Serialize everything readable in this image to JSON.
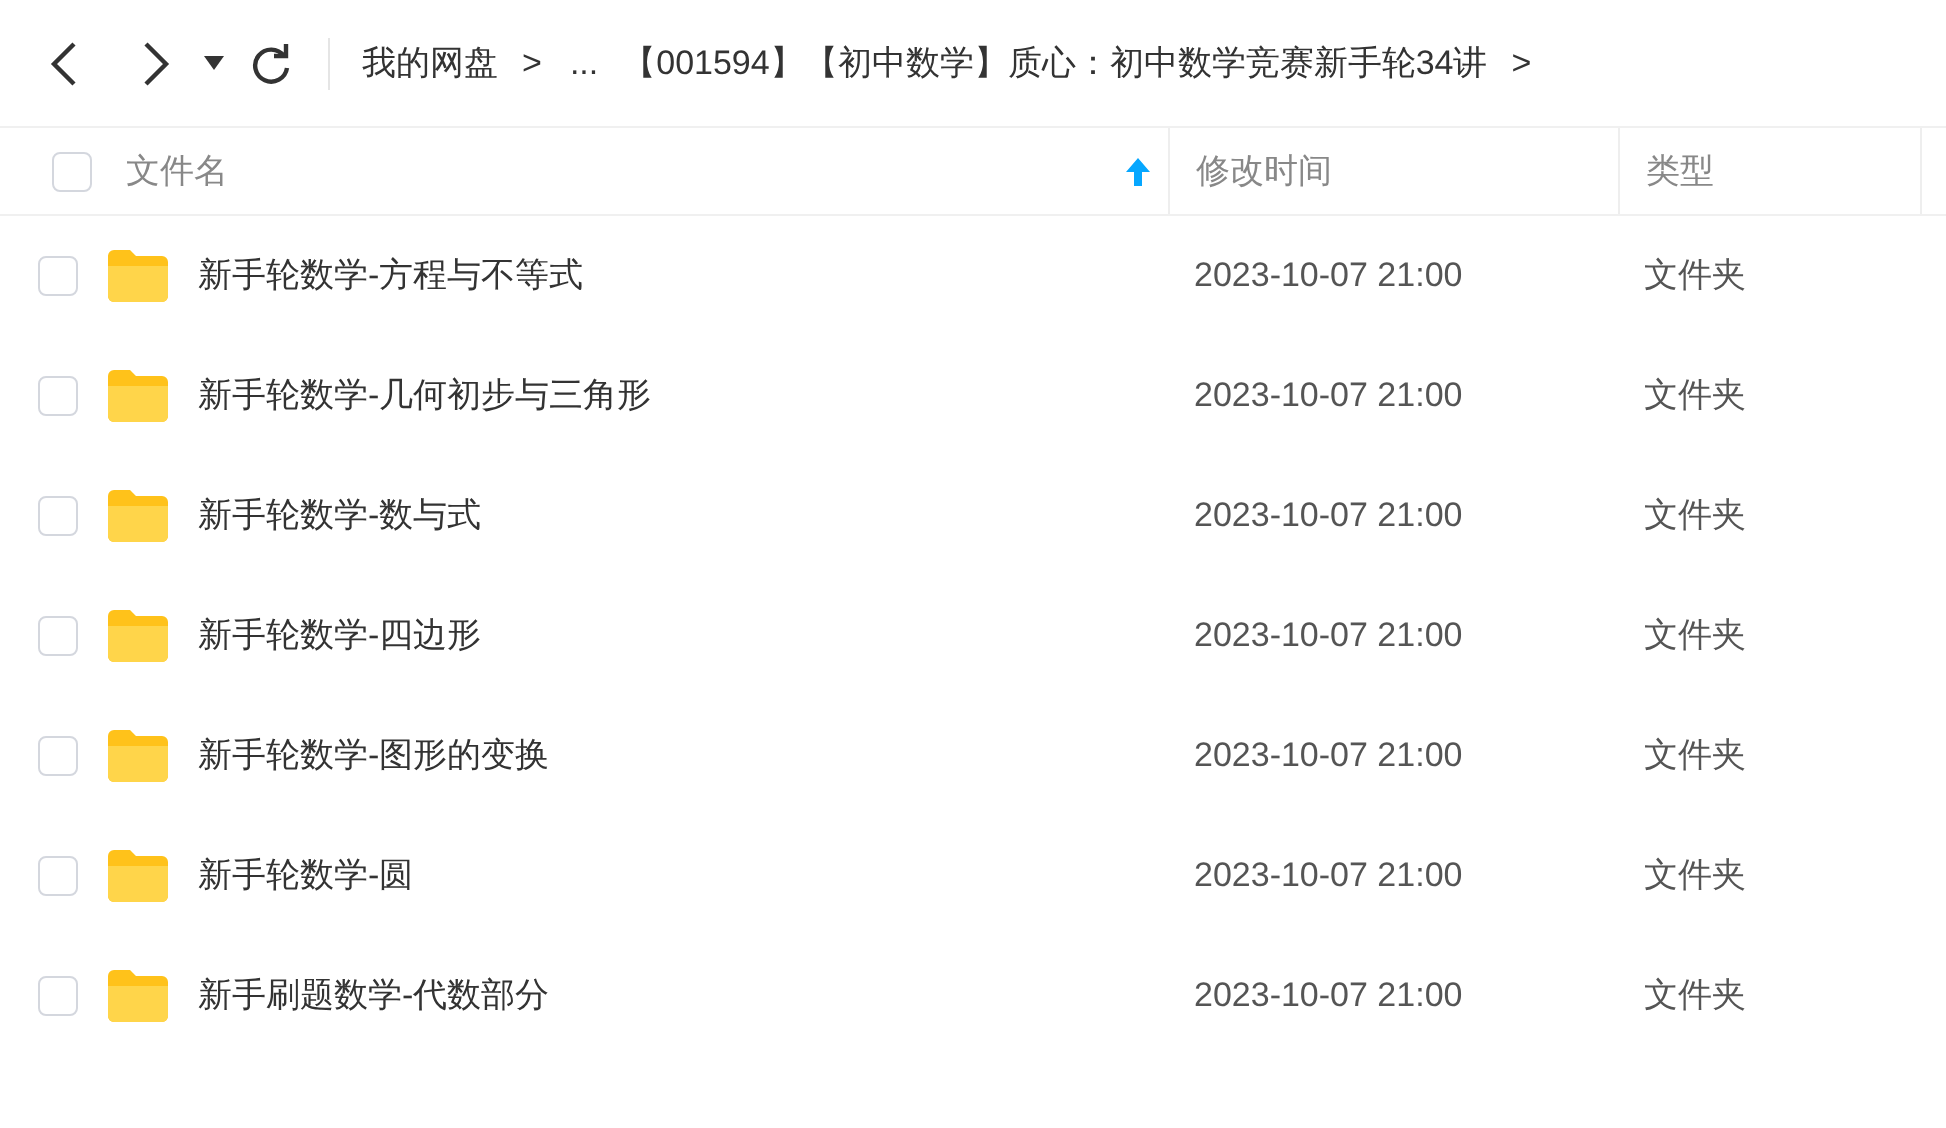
{
  "nav": {
    "breadcrumb": [
      {
        "label": "我的网盘",
        "separator": ">"
      },
      {
        "label": "..."
      },
      {
        "label": "【001594】【初中数学】质心：初中数学竞赛新手轮34讲",
        "separator": ">"
      }
    ]
  },
  "table": {
    "select_all": {
      "checked": false
    },
    "columns": [
      {
        "label": "文件名",
        "sorted": true
      },
      {
        "label": "修改时间",
        "sorted": false
      },
      {
        "label": "类型",
        "sorted": false
      }
    ],
    "rows": [
      {
        "checked": false,
        "name": "新手轮数学-方程与不等式",
        "modified": "2023-10-07 21:00",
        "type": "文件夹"
      },
      {
        "checked": false,
        "name": "新手轮数学-几何初步与三角形",
        "modified": "2023-10-07 21:00",
        "type": "文件夹"
      },
      {
        "checked": false,
        "name": "新手轮数学-数与式",
        "modified": "2023-10-07 21:00",
        "type": "文件夹"
      },
      {
        "checked": false,
        "name": "新手轮数学-四边形",
        "modified": "2023-10-07 21:00",
        "type": "文件夹"
      },
      {
        "checked": false,
        "name": "新手轮数学-图形的变换",
        "modified": "2023-10-07 21:00",
        "type": "文件夹"
      },
      {
        "checked": false,
        "name": "新手轮数学-圆",
        "modified": "2023-10-07 21:00",
        "type": "文件夹"
      },
      {
        "checked": false,
        "name": "新手刷题数学-代数部分",
        "modified": "2023-10-07 21:00",
        "type": "文件夹"
      }
    ]
  }
}
